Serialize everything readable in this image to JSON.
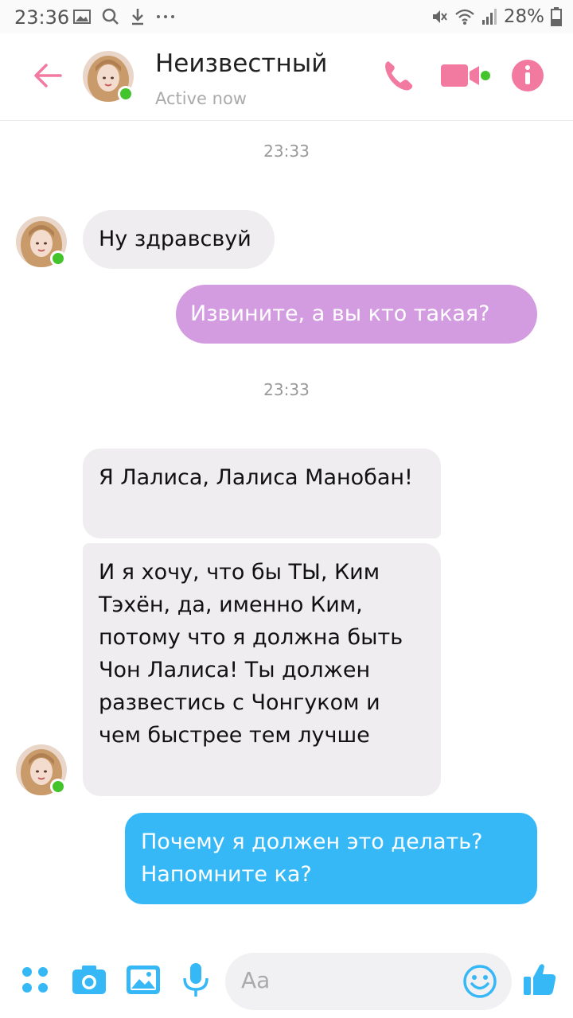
{
  "status_bar": {
    "time": "23:36",
    "battery": "28%"
  },
  "header": {
    "contact_name": "Неизвестный",
    "status": "Active now"
  },
  "colors": {
    "accent": "#f2799f",
    "incoming_bubble": "#efedf0",
    "outgoing_purple": "#d49ce0",
    "outgoing_blue": "#36b8f7",
    "online": "#44c42c"
  },
  "messages": {
    "ts1": "23:33",
    "m1": "Ну здравсвуй",
    "m2": "Извините, а вы кто такая?",
    "ts2": "23:33",
    "m3": "Я Лалиса, Лалиса Манобан!",
    "m4": "И я хочу, что бы ТЫ, Ким Тэхён, да, именно Ким, потому что я должна быть Чон Лалиса! Ты должен развестись с Чонгуком и чем быстрее тем лучше",
    "m5": "Почему я должен это делать? Напомните ка?"
  },
  "composer": {
    "placeholder": "Aa"
  }
}
